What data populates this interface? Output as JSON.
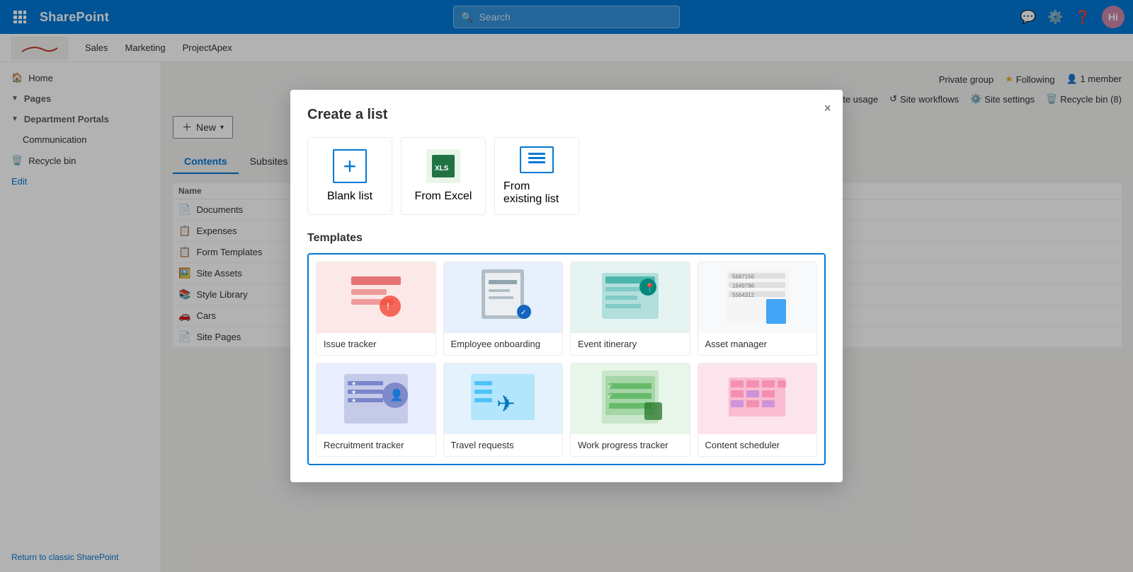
{
  "app": {
    "title": "SharePoint"
  },
  "topbar": {
    "search_placeholder": "Search",
    "avatar_initials": "Hi"
  },
  "subnav": {
    "links": [
      "Sales",
      "Marketing",
      "ProjectApex"
    ]
  },
  "sidebar": {
    "home": "Home",
    "pages_group": "Pages",
    "department_portals_group": "Department Portals",
    "communication": "Communication",
    "recycle_bin": "Recycle bin",
    "edit": "Edit",
    "return_link": "Return to classic SharePoint"
  },
  "content": {
    "new_button": "New",
    "tabs": [
      "Contents",
      "Subsites"
    ],
    "active_tab": "Contents",
    "table_header": "Name",
    "rows": [
      {
        "icon": "📄",
        "name": "Documents"
      },
      {
        "icon": "📋",
        "name": "Expenses"
      },
      {
        "icon": "📋",
        "name": "Form Templates"
      },
      {
        "icon": "🖼️",
        "name": "Site Assets"
      },
      {
        "icon": "📚",
        "name": "Style Library"
      },
      {
        "icon": "🚗",
        "name": "Cars"
      },
      {
        "icon": "📄",
        "name": "Site Pages"
      }
    ]
  },
  "top_right": {
    "private_group": "Private group",
    "following_label": "Following",
    "members": "1 member",
    "site_usage": "Site usage",
    "site_workflows": "Site workflows",
    "site_settings": "Site settings",
    "recycle_bin": "Recycle bin (8)"
  },
  "modal": {
    "title": "Create a list",
    "close_label": "×",
    "create_options": [
      {
        "id": "blank",
        "icon": "+",
        "label": "Blank list"
      },
      {
        "id": "excel",
        "icon": "xlsx",
        "label": "From Excel"
      },
      {
        "id": "existing",
        "icon": "≡",
        "label": "From existing list"
      }
    ],
    "templates_title": "Templates",
    "templates": [
      {
        "id": "issue",
        "name": "Issue tracker",
        "thumb_class": "thumb-issue"
      },
      {
        "id": "employee",
        "name": "Employee onboarding",
        "thumb_class": "thumb-employee"
      },
      {
        "id": "event",
        "name": "Event itinerary",
        "thumb_class": "thumb-event"
      },
      {
        "id": "asset",
        "name": "Asset manager",
        "thumb_class": "thumb-asset"
      },
      {
        "id": "recruitment",
        "name": "Recruitment tracker",
        "thumb_class": "thumb-recruitment"
      },
      {
        "id": "travel",
        "name": "Travel requests",
        "thumb_class": "thumb-travel"
      },
      {
        "id": "work",
        "name": "Work progress tracker",
        "thumb_class": "thumb-work"
      },
      {
        "id": "content",
        "name": "Content scheduler",
        "thumb_class": "thumb-content"
      }
    ]
  }
}
